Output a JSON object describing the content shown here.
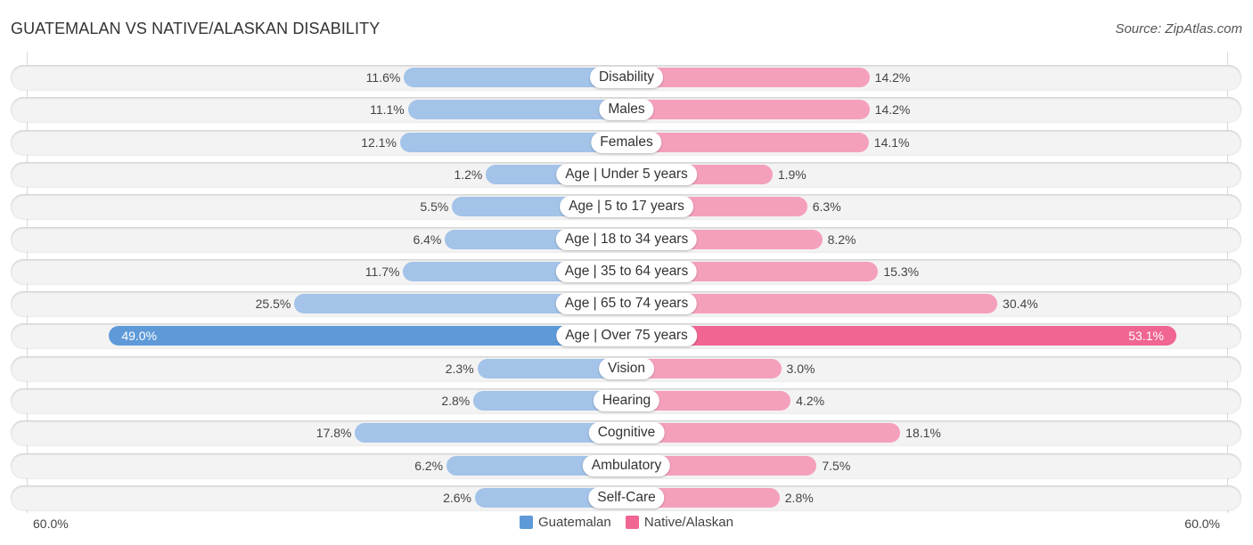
{
  "header": {
    "title": "GUATEMALAN VS NATIVE/ALASKAN DISABILITY",
    "source": "Source: ZipAtlas.com"
  },
  "colors": {
    "guatemalan": "#a3c3e8",
    "guatemalan_strong": "#5e9ad8",
    "native": "#f5a0bb",
    "native_strong": "#f06591"
  },
  "chart_data": {
    "type": "bar",
    "orientation": "diverging-horizontal",
    "title": "GUATEMALAN VS NATIVE/ALASKAN DISABILITY",
    "categories": [
      "Disability",
      "Males",
      "Females",
      "Age | Under 5 years",
      "Age | 5 to 17 years",
      "Age | 18 to 34 years",
      "Age | 35 to 64 years",
      "Age | 65 to 74 years",
      "Age | Over 75 years",
      "Vision",
      "Hearing",
      "Cognitive",
      "Ambulatory",
      "Self-Care"
    ],
    "series": [
      {
        "name": "Guatemalan",
        "side": "left",
        "values": [
          11.6,
          11.1,
          12.1,
          1.2,
          5.5,
          6.4,
          11.7,
          25.5,
          49.0,
          2.3,
          2.8,
          17.8,
          6.2,
          2.6
        ]
      },
      {
        "name": "Native/Alaskan",
        "side": "right",
        "values": [
          14.2,
          14.2,
          14.1,
          1.9,
          6.3,
          8.2,
          15.3,
          30.4,
          53.1,
          3.0,
          4.2,
          18.1,
          7.5,
          2.8
        ]
      }
    ],
    "unit": "%",
    "xlim": [
      0,
      60.0
    ],
    "axis_labels": {
      "left": "60.0%",
      "right": "60.0%"
    },
    "legend": [
      "Guatemalan",
      "Native/Alaskan"
    ],
    "legend_position": "bottom-center"
  }
}
